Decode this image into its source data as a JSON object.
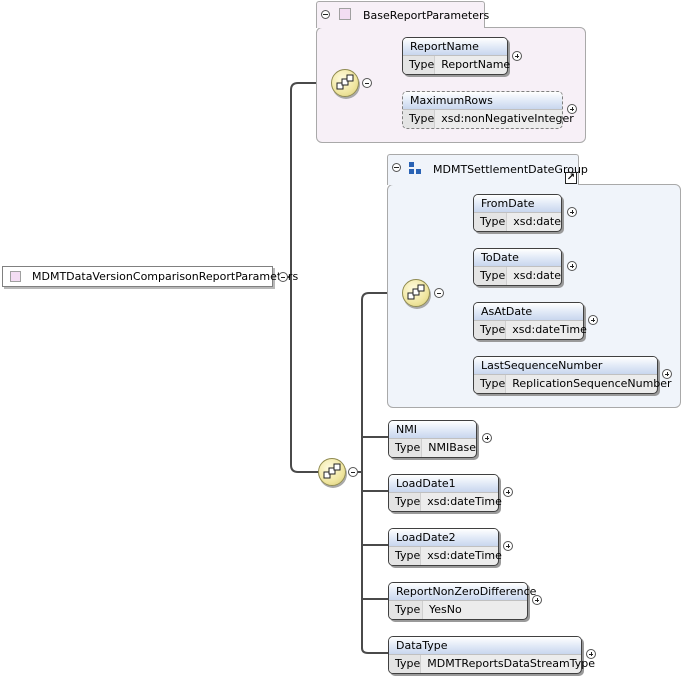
{
  "root": {
    "label": "MDMTDataVersionComparisonReportParameters"
  },
  "base_group": {
    "label": "BaseReportParameters"
  },
  "mdmt_group": {
    "label": "MDMTSettlementDateGroup"
  },
  "type_key": "Type",
  "base_elements": [
    {
      "name": "ReportName",
      "type": "ReportName"
    },
    {
      "name": "MaximumRows",
      "type": "xsd:nonNegativeInteger"
    }
  ],
  "group_elements": [
    {
      "name": "FromDate",
      "type": "xsd:date"
    },
    {
      "name": "ToDate",
      "type": "xsd:date"
    },
    {
      "name": "AsAtDate",
      "type": "xsd:dateTime"
    },
    {
      "name": "LastSequenceNumber",
      "type": "ReplicationSequenceNumber"
    }
  ],
  "main_elements": [
    {
      "name": "NMI",
      "type": "NMIBase"
    },
    {
      "name": "LoadDate1",
      "type": "xsd:dateTime"
    },
    {
      "name": "LoadDate2",
      "type": "xsd:dateTime"
    },
    {
      "name": "ReportNonZeroDifference",
      "type": "YesNo"
    },
    {
      "name": "DataType",
      "type": "MDMTReportsDataStreamType"
    }
  ]
}
